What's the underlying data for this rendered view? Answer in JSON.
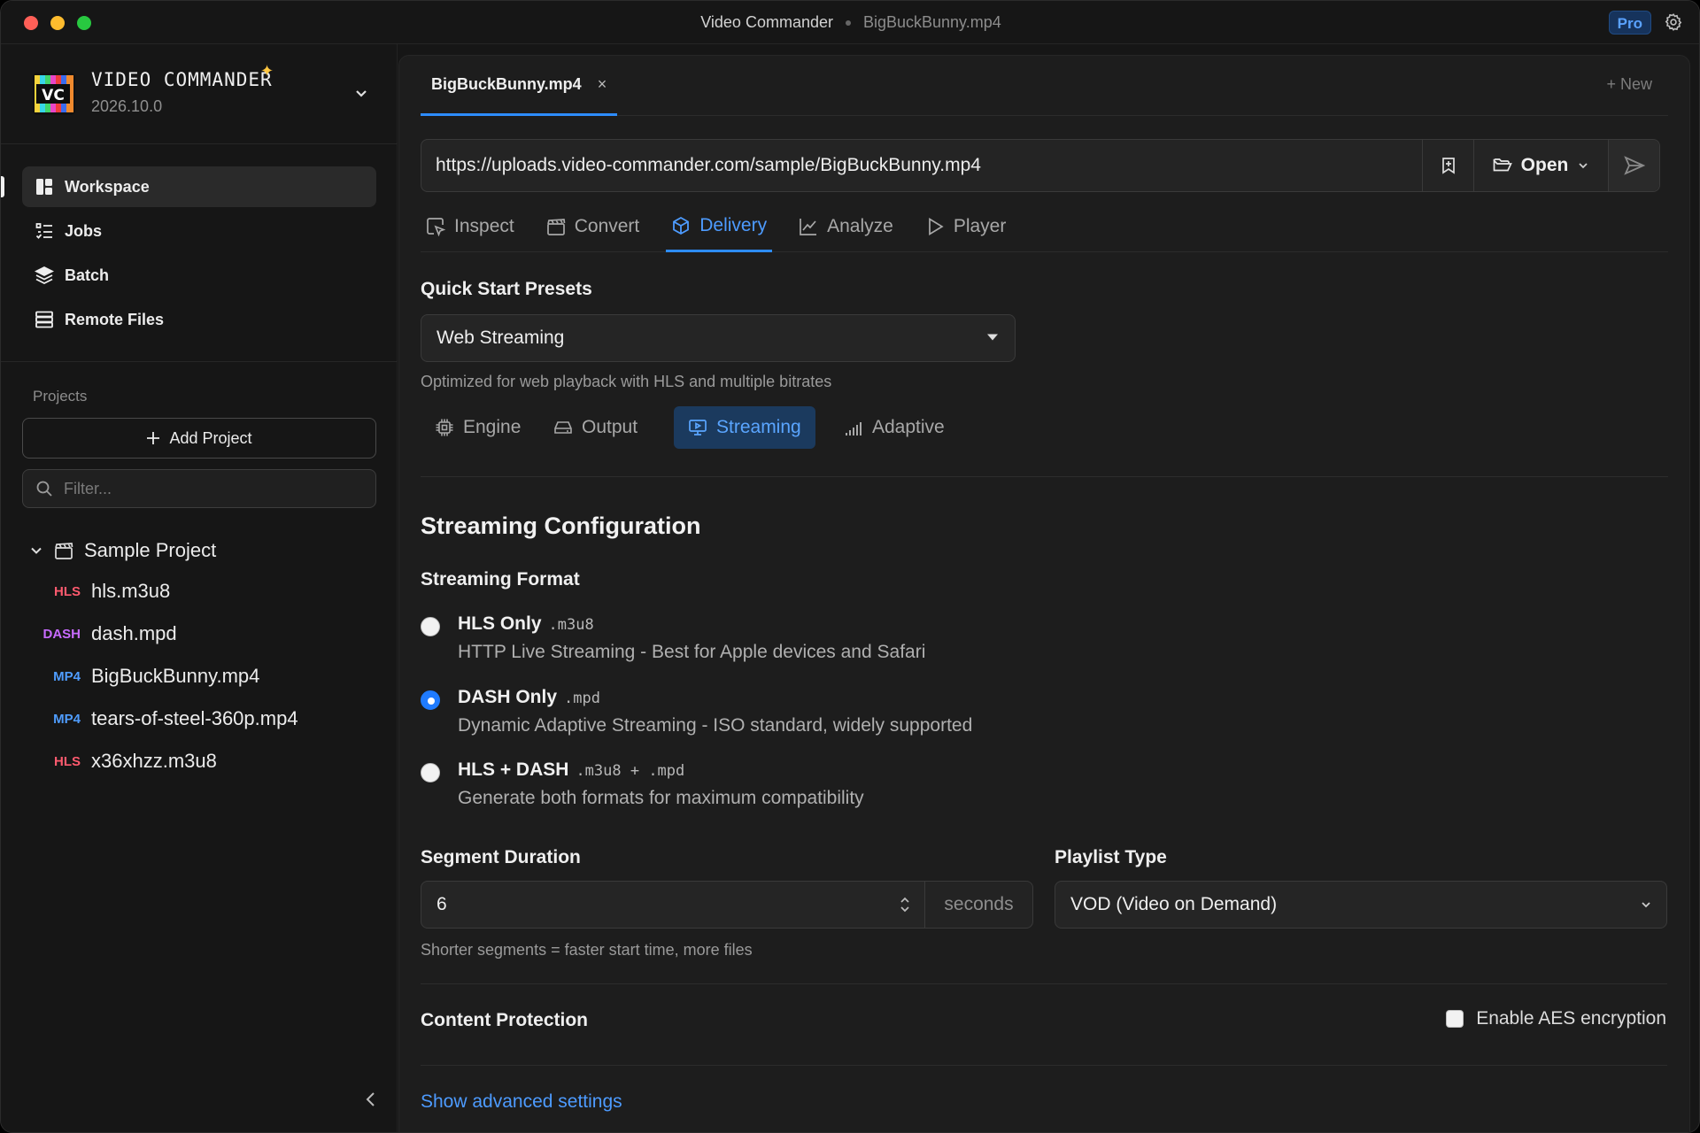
{
  "window": {
    "app_title": "Video Commander",
    "file_title": "BigBuckBunny.mp4",
    "pro_badge": "Pro"
  },
  "brand": {
    "logo_text": "VC",
    "name": "VIDEO COMMANDER",
    "version": "2026.10.0"
  },
  "nav": {
    "items": [
      {
        "label": "Workspace",
        "icon": "workspace-icon",
        "active": true
      },
      {
        "label": "Jobs",
        "icon": "jobs-list-icon"
      },
      {
        "label": "Batch",
        "icon": "layers-icon"
      },
      {
        "label": "Remote Files",
        "icon": "server-icon"
      }
    ]
  },
  "projects": {
    "label": "Projects",
    "add_label": "Add Project",
    "filter_placeholder": "Filter...",
    "tree": {
      "root": "Sample Project",
      "files": [
        {
          "tag": "HLS",
          "name": "hls.m3u8",
          "kind": "hls"
        },
        {
          "tag": "DASH",
          "name": "dash.mpd",
          "kind": "dash"
        },
        {
          "tag": "MP4",
          "name": "BigBuckBunny.mp4",
          "kind": "mp4"
        },
        {
          "tag": "MP4",
          "name": "tears-of-steel-360p.mp4",
          "kind": "mp4"
        },
        {
          "tag": "HLS",
          "name": "x36xhzz.m3u8",
          "kind": "hls"
        }
      ]
    }
  },
  "tabs": {
    "file_tab": "BigBuckBunny.mp4",
    "close": "×",
    "new_label": "+ New"
  },
  "urlbar": {
    "value": "https://uploads.video-commander.com/sample/BigBuckBunny.mp4",
    "open_label": "Open"
  },
  "mode_tabs": [
    {
      "label": "Inspect",
      "icon": "inspect-icon"
    },
    {
      "label": "Convert",
      "icon": "clapper-icon"
    },
    {
      "label": "Delivery",
      "icon": "package-icon",
      "active": true
    },
    {
      "label": "Analyze",
      "icon": "chart-line-icon"
    },
    {
      "label": "Player",
      "icon": "play-icon"
    }
  ],
  "presets": {
    "label": "Quick Start Presets",
    "selected": "Web Streaming",
    "help": "Optimized for web playback with HLS and multiple bitrates"
  },
  "sub_tabs": [
    {
      "label": "Engine",
      "icon": "cpu-icon"
    },
    {
      "label": "Output",
      "icon": "drive-icon"
    },
    {
      "label": "Streaming",
      "icon": "screen-play-icon",
      "active": true
    },
    {
      "label": "Adaptive",
      "icon": "signal-bars-icon"
    }
  ],
  "streaming": {
    "title": "Streaming Configuration",
    "format_label": "Streaming Format",
    "options": [
      {
        "title": "HLS Only",
        "ext": ".m3u8",
        "desc": "HTTP Live Streaming - Best for Apple devices and Safari",
        "selected": false
      },
      {
        "title": "DASH Only",
        "ext": ".mpd",
        "desc": "Dynamic Adaptive Streaming - ISO standard, widely supported",
        "selected": true
      },
      {
        "title": "HLS + DASH",
        "ext": ".m3u8 + .mpd",
        "desc": "Generate both formats for maximum compatibility",
        "selected": false
      }
    ],
    "segment": {
      "label": "Segment Duration",
      "value": "6",
      "unit": "seconds",
      "help": "Shorter segments = faster start time, more files"
    },
    "playlist": {
      "label": "Playlist Type",
      "selected": "VOD (Video on Demand)"
    },
    "protection": {
      "label": "Content Protection",
      "checkbox_label": "Enable AES encryption",
      "checked": false
    },
    "advanced_link": "Show advanced settings"
  },
  "colors": {
    "accent": "#2d8cff",
    "hls_tag": "#ff5a6e",
    "dash_tag": "#c86bff",
    "mp4_tag": "#4f9dff",
    "spark": "#ffc640"
  }
}
